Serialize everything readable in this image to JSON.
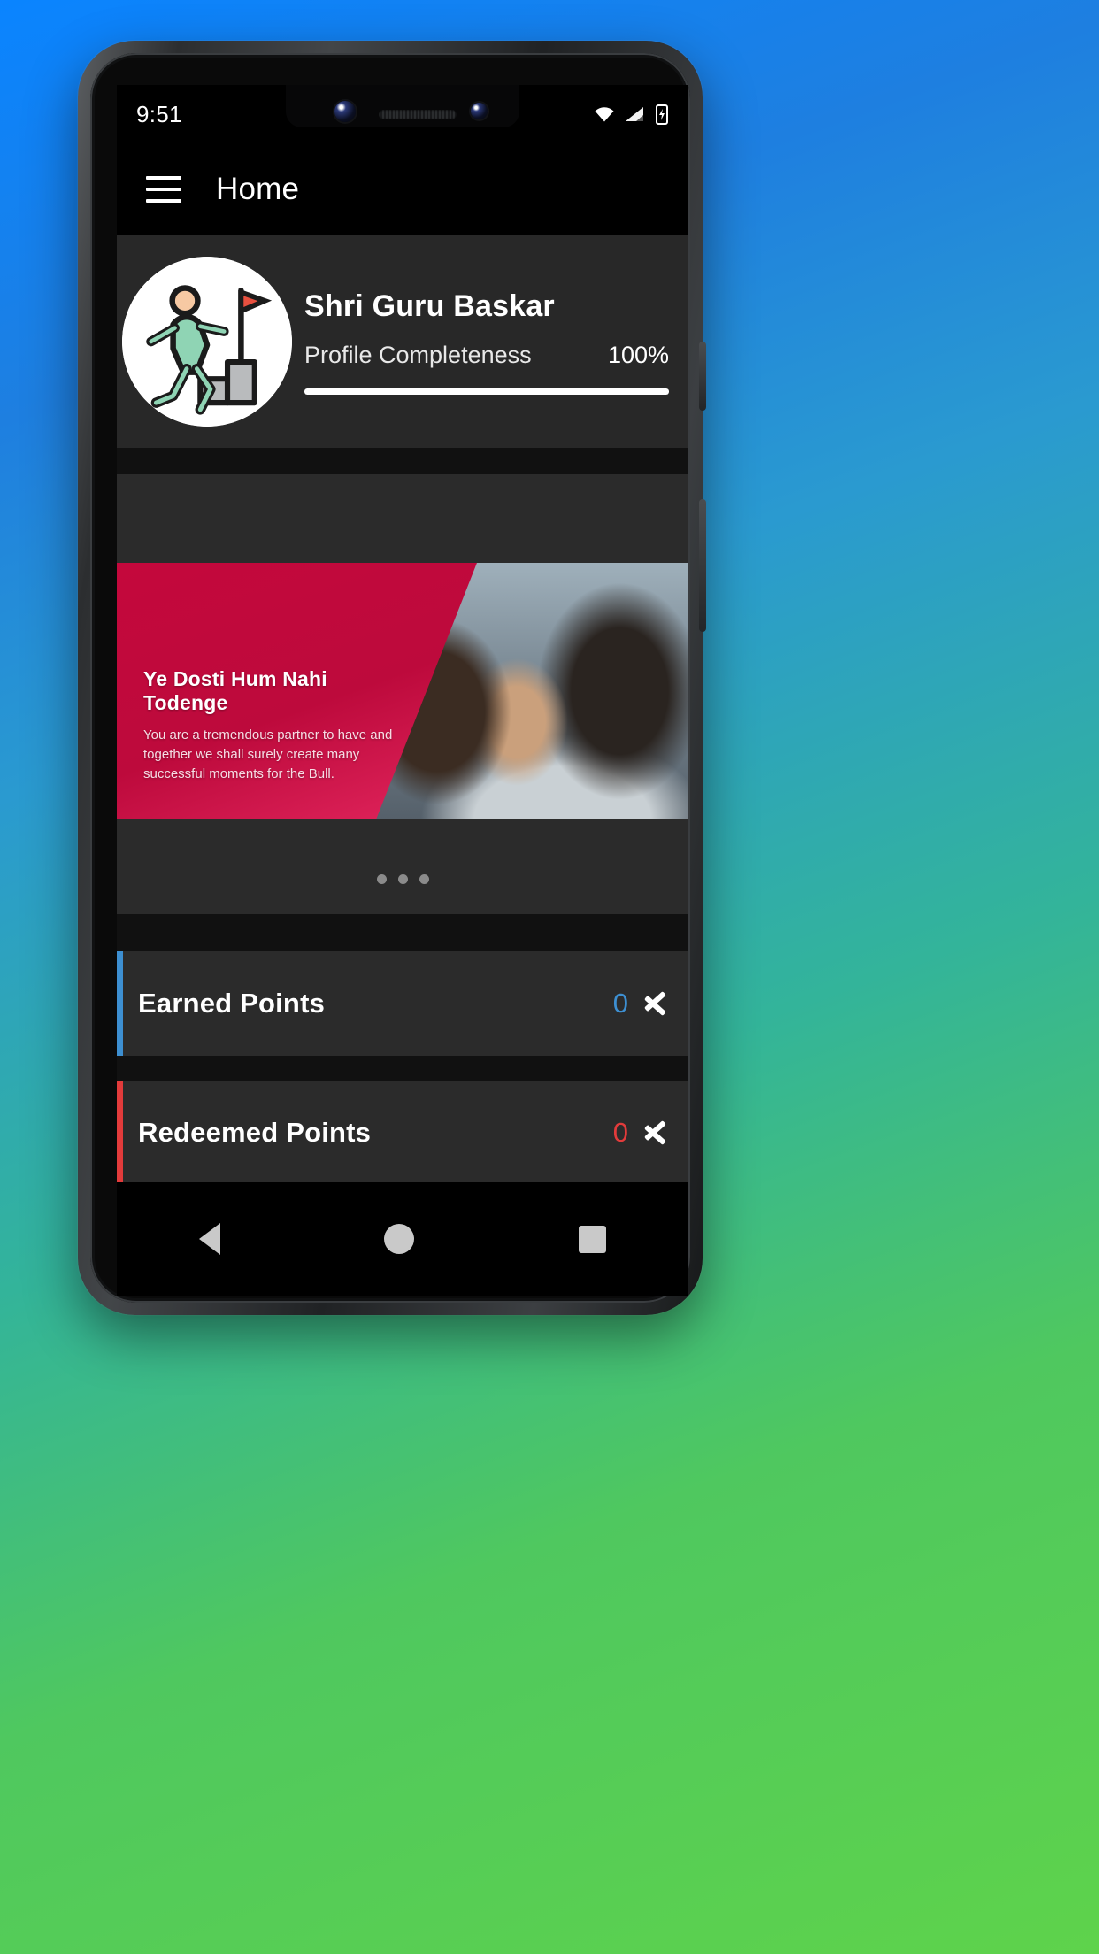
{
  "status_bar": {
    "time": "9:51",
    "icons": [
      "wifi-icon",
      "cellular-signal-icon",
      "battery-charging-icon"
    ]
  },
  "app_bar": {
    "menu_icon": "hamburger-menu-icon",
    "title": "Home"
  },
  "profile": {
    "avatar_icon": "runner-climbing-stairs-avatar",
    "name": "Shri Guru Baskar",
    "completeness_label": "Profile Completeness",
    "completeness_value": "100%",
    "progress_percent": 100
  },
  "banner": {
    "headline": "Ye Dosti Hum Nahi Todenge",
    "subtext": "You are a tremendous partner to have and together we shall surely create many successful moments for the Bull.",
    "accent_color": "#BD0A3C",
    "dots_total": 3,
    "active_dot_index": 0
  },
  "points": [
    {
      "label": "Earned Points",
      "value": "0",
      "accent_color": "#3D8FD1",
      "value_color": "#3D8FD1",
      "chevron_icon": "chevron-right-icon"
    },
    {
      "label": "Redeemed Points",
      "value": "0",
      "accent_color": "#E23B3B",
      "value_color": "#E23B3B",
      "chevron_icon": "chevron-right-icon"
    }
  ],
  "nav_bar": {
    "back_label": "back-icon",
    "home_label": "home-icon",
    "recents_label": "recents-icon"
  }
}
